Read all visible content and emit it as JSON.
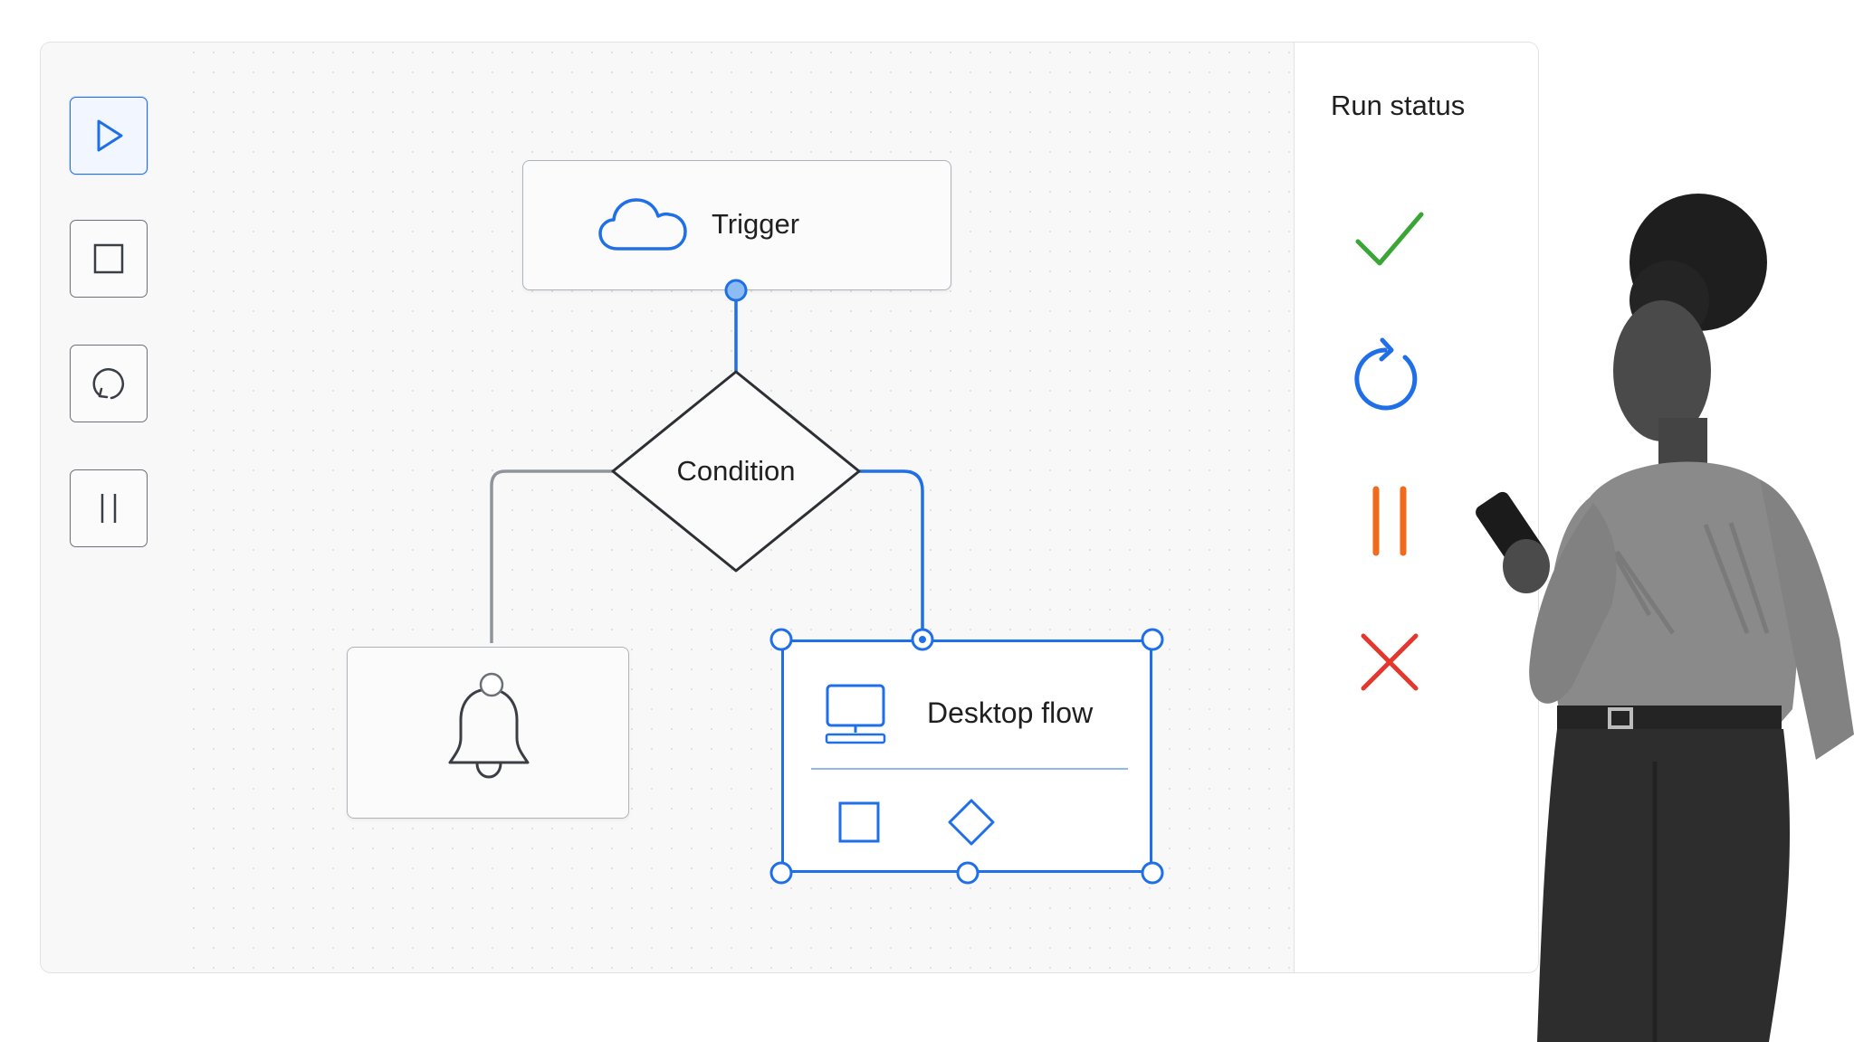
{
  "toolbar": {
    "buttons": [
      {
        "name": "play",
        "icon": "play-icon",
        "active": true
      },
      {
        "name": "stop",
        "icon": "stop-icon",
        "active": false
      },
      {
        "name": "refresh",
        "icon": "refresh-icon",
        "active": false
      },
      {
        "name": "pause",
        "icon": "pause-icon",
        "active": false
      }
    ]
  },
  "flow": {
    "trigger_label": "Trigger",
    "condition_label": "Condition",
    "desktop_flow_label": "Desktop flow",
    "trigger_icon": "cloud-icon",
    "notification_icon": "bell-icon",
    "desktop_icon": "desktop-computer-icon"
  },
  "status_panel": {
    "title": "Run status",
    "statuses": [
      {
        "icon": "check-icon",
        "color": "#3aa635"
      },
      {
        "icon": "refresh-icon",
        "color": "#1f6fe8"
      },
      {
        "icon": "pause-icon",
        "color": "#f26a1b"
      },
      {
        "icon": "close-icon",
        "color": "#e6372f"
      }
    ]
  },
  "colors": {
    "accent": "#1f6fe8",
    "neutral": "#6a6f78"
  }
}
